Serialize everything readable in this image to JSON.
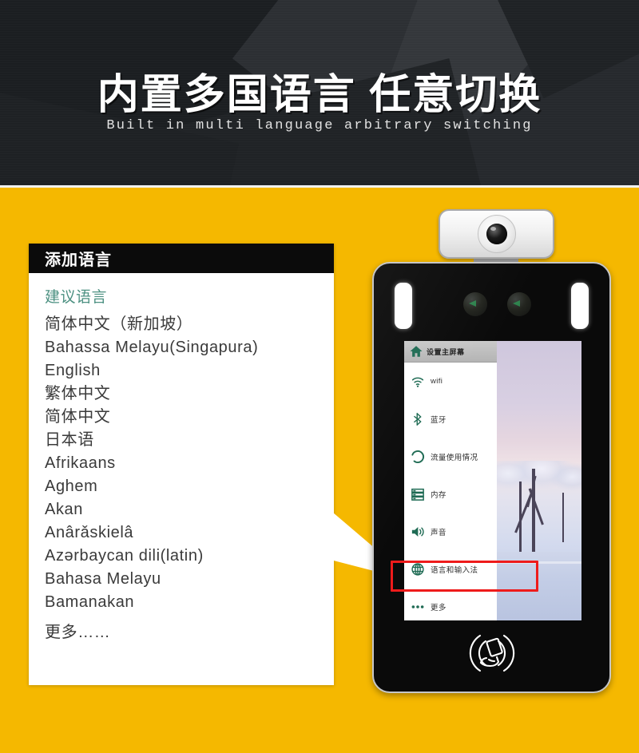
{
  "header": {
    "title": "内置多国语言 任意切换",
    "subtitle": "Built in multi language arbitrary switching"
  },
  "colors": {
    "background_yellow": "#F5B800",
    "header_dark": "#1b1e21",
    "panel_header_black": "#0b0b0b",
    "section_green": "#4d9182",
    "menu_icon_green": "#1f6b54",
    "highlight_red": "#ee1b1b"
  },
  "language_panel": {
    "header_title": "添加语言",
    "section_label": "建议语言",
    "items": [
      "简体中文（新加坡）",
      "Bahassa Melayu(Singapura)",
      "English",
      "繁体中文",
      "简体中文",
      "日本语",
      "Afrikaans",
      "Aghem",
      "Akan",
      "Anârǎskielâ",
      "Azərbaycan dili(latin)",
      "Bahasa Melayu",
      "Bamanakan"
    ],
    "more_label": "更多……"
  },
  "device": {
    "camera_module": {
      "icon": "camera-lens-icon"
    },
    "indicators": {
      "led_left": "led-light-panel-left",
      "led_right": "led-light-panel-right",
      "sensor_left": "camera-sensor-left",
      "sensor_right": "camera-sensor-right"
    },
    "nfc_icon": "nfc-card-swipe-icon",
    "wallpaper": "winter-snow-tree-photo",
    "settings_menu": {
      "header": {
        "label": "设置主屏幕",
        "icon": "home-icon"
      },
      "rows": [
        {
          "label": "wifi",
          "icon": "wifi-icon"
        },
        {
          "label": "蓝牙",
          "icon": "bluetooth-icon"
        },
        {
          "label": "流量使用情况",
          "icon": "data-usage-icon"
        },
        {
          "label": "内存",
          "icon": "storage-icon"
        },
        {
          "label": "声音",
          "icon": "sound-icon"
        },
        {
          "label": "语言和输入法",
          "icon": "globe-icon",
          "highlighted": true
        },
        {
          "label": "更多",
          "icon": "more-dots-icon"
        }
      ]
    }
  }
}
